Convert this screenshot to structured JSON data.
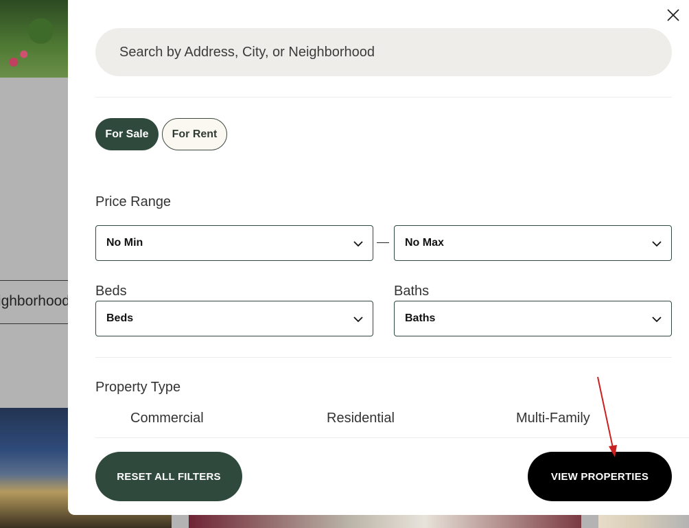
{
  "background": {
    "search_partial_text": "eighborhood"
  },
  "search": {
    "placeholder": "Search by Address, City, or Neighborhood"
  },
  "listing_type": {
    "for_sale_label": "For Sale",
    "for_rent_label": "For Rent",
    "selected": "For Sale"
  },
  "price_range": {
    "label": "Price Range",
    "min_value": "No Min",
    "max_value": "No Max"
  },
  "beds": {
    "label": "Beds",
    "value": "Beds"
  },
  "baths": {
    "label": "Baths",
    "value": "Baths"
  },
  "property_type": {
    "label": "Property Type",
    "options": [
      "Commercial",
      "Residential",
      "Multi-Family"
    ]
  },
  "actions": {
    "reset_label": "RESET ALL FILTERS",
    "view_label": "VIEW PROPERTIES"
  },
  "colors": {
    "accent_green": "#2f4a3d",
    "annotation_arrow": "#cc1f1f"
  },
  "icons": {
    "close": "close-icon",
    "chevron": "chevron-down-icon"
  }
}
